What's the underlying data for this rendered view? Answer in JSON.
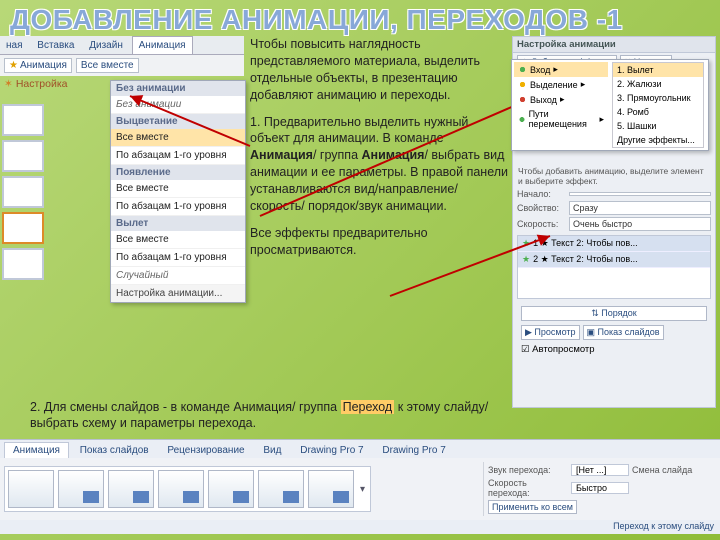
{
  "title": "Добавление анимации, переходов -1",
  "body": {
    "p1": "Чтобы повысить наглядность представляемого материала, выделить отдельные объекты, в презентацию добавляют анимацию и переходы.",
    "p2a": "1. Предварительно выделить нужный объект для анимации. В команде ",
    "p2_bold1": "Анимация",
    "p2b": "/ группа ",
    "p2_bold2": "Анимация",
    "p2c": "/ выбрать вид анимации и ее параметры. В правой панели устанавливаются вид/направление/скорость/ порядок/звук анимации.",
    "p3": "Все эффекты предварительно просматриваются.",
    "p4a": "2. Для смены слайдов - в команде Анимация/ группа ",
    "p4_hl": "Переход",
    "p4b": " к этому слайду/ выбрать схему и параметры перехода."
  },
  "ribbon": {
    "tabs": [
      "ная",
      "Вставка",
      "Дизайн",
      "Анимация"
    ],
    "anim_btn": "Анимация",
    "combo": "Все вместе",
    "settings": "Настройка"
  },
  "dropdown": {
    "sections": [
      {
        "head": "Без анимации",
        "items": [
          "Без анимации"
        ]
      },
      {
        "head": "Выцветание",
        "items": [
          "Все вместе",
          "По абзацам 1-го уровня"
        ]
      },
      {
        "head": "Появление",
        "items": [
          "Все вместе",
          "По абзацам 1-го уровня"
        ]
      },
      {
        "head": "Вылет",
        "items": [
          "Все вместе",
          "По абзацам 1-го уровня"
        ]
      },
      {
        "head": "Случайный",
        "items": [
          "Случайный"
        ]
      }
    ],
    "sel_index": 1,
    "footer": "Настройка анимации..."
  },
  "right": {
    "title": "Настройка анимации",
    "add": "Добавить эффект",
    "remove": "Удалить",
    "menu_l": [
      {
        "lbl": "Вход",
        "cls": "g"
      },
      {
        "lbl": "Выделение",
        "cls": "y"
      },
      {
        "lbl": "Выход",
        "cls": "r"
      },
      {
        "lbl": "Пути перемещения",
        "cls": "g"
      }
    ],
    "menu_r": [
      "1. Вылет",
      "2. Жалюзи",
      "3. Прямоугольник",
      "4. Ромб",
      "5. Шашки",
      "Другие эффекты..."
    ],
    "hint": "Чтобы добавить анимацию, выделите элемент и выберите эффект.",
    "f_start_l": "Начало:",
    "f_start_v": "",
    "f_dir_l": "Свойство:",
    "f_dir_v": "Сразу",
    "f_speed_l": "Скорость:",
    "f_speed_v": "Очень быстро",
    "list": [
      "1 ★ Текст 2: Чтобы пов...",
      "2 ★ Текст 2: Чтобы пов..."
    ],
    "reorder": "Порядок",
    "play": "Просмотр",
    "slideshow": "Показ слайдов",
    "auto": "Автопросмотр"
  },
  "bottom": {
    "tabs": [
      "Анимация",
      "Показ слайдов",
      "Рецензирование",
      "Вид",
      "Drawing Pro 7",
      "Drawing Pro 7"
    ],
    "right": {
      "sound_l": "Звук перехода:",
      "sound_v": "[Нет ...]",
      "speed_l": "Скорость перехода:",
      "speed_v": "Быстро",
      "apply": "Применить ко всем",
      "change_l": "Смена слайда",
      "foot": "Переход к этому слайду"
    }
  }
}
